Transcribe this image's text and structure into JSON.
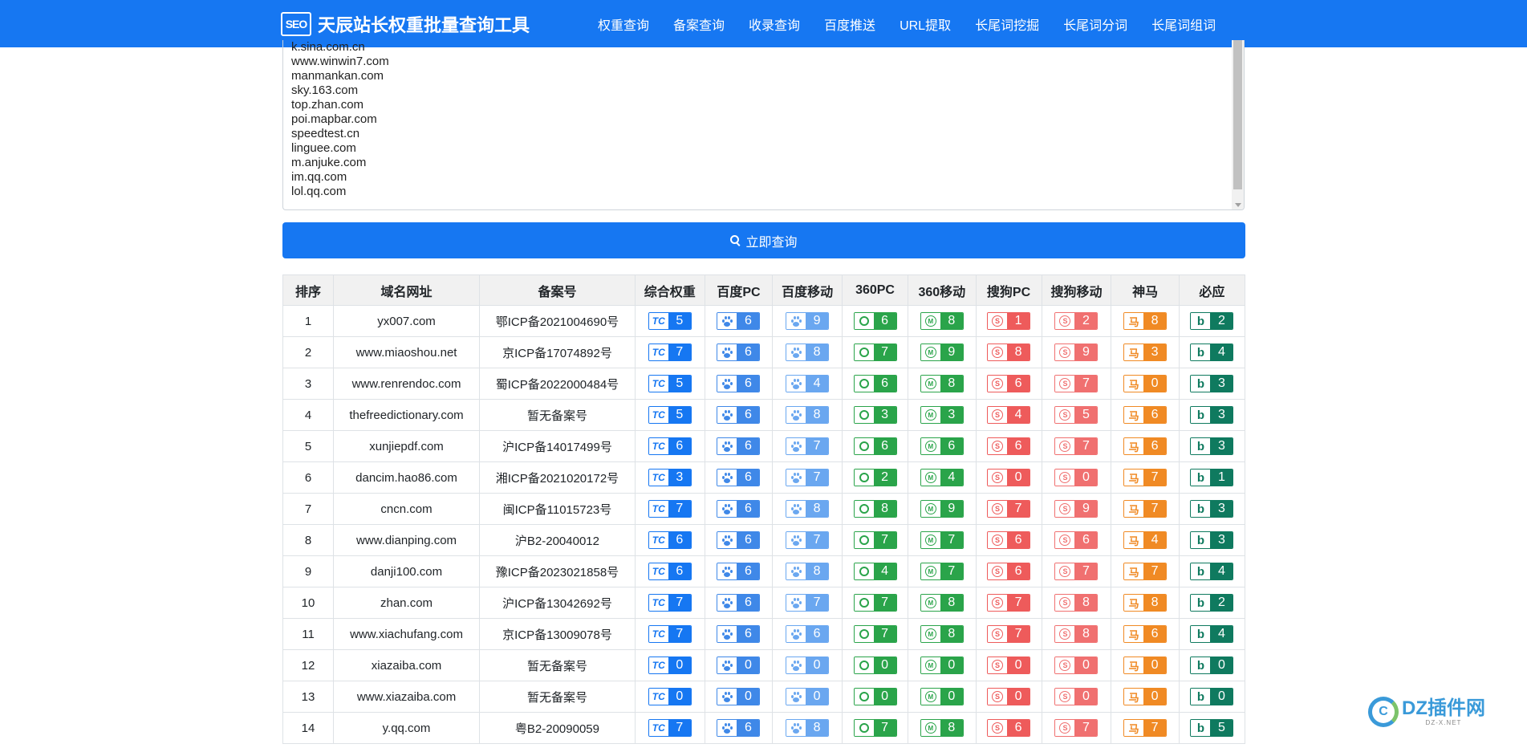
{
  "header": {
    "logo_text": "SEO",
    "title": "天辰站长权重批量查询工具",
    "nav": [
      "权重查询",
      "备案查询",
      "收录查询",
      "百度推送",
      "URL提取",
      "长尾词挖掘",
      "长尾词分词",
      "长尾词组词"
    ]
  },
  "textarea": {
    "lines": [
      "k.sina.com.cn",
      "www.winwin7.com",
      "manmankan.com",
      "sky.163.com",
      "top.zhan.com",
      "poi.mapbar.com",
      "speedtest.cn",
      "linguee.com",
      "m.anjuke.com",
      "im.qq.com",
      "lol.qq.com"
    ]
  },
  "query_button": {
    "label": "立即查询",
    "icon": "search-icon"
  },
  "table": {
    "headers": [
      "排序",
      "域名网址",
      "备案号",
      "综合权重",
      "百度PC",
      "百度移动",
      "360PC",
      "360移动",
      "搜狗PC",
      "搜狗移动",
      "神马",
      "必应"
    ],
    "engines": [
      {
        "key": "aizhan",
        "icon": "aizhan-icon",
        "glyph": "TC",
        "color": "#1677f2"
      },
      {
        "key": "baidu_pc",
        "icon": "baidu-paw-icon",
        "glyph": "",
        "color": "#3f88e8"
      },
      {
        "key": "baidu_m",
        "icon": "baidu-paw-icon",
        "glyph": "",
        "color": "#6aa7f0"
      },
      {
        "key": "s360_pc",
        "icon": "360-icon",
        "glyph": "",
        "color": "#2aa44a"
      },
      {
        "key": "s360_m",
        "icon": "360-mobile-icon",
        "glyph": "M",
        "color": "#2aa44a"
      },
      {
        "key": "sogou_pc",
        "icon": "sogou-icon",
        "glyph": "S",
        "color": "#ee5b5b"
      },
      {
        "key": "sogou_m",
        "icon": "sogou-mobile-icon",
        "glyph": "S",
        "color": "#f07070"
      },
      {
        "key": "shenma",
        "icon": "shenma-icon",
        "glyph": "马",
        "color": "#f08a24"
      },
      {
        "key": "bing",
        "icon": "bing-icon",
        "glyph": "b",
        "color": "#0f7a5f"
      }
    ],
    "rows": [
      {
        "rank": "1",
        "domain": "yx007.com",
        "icp": "鄂ICP备2021004690号",
        "scores": [
          "5",
          "6",
          "9",
          "6",
          "8",
          "1",
          "2",
          "8",
          "2"
        ]
      },
      {
        "rank": "2",
        "domain": "www.miaoshou.net",
        "icp": "京ICP备17074892号",
        "scores": [
          "7",
          "6",
          "8",
          "7",
          "9",
          "8",
          "9",
          "3",
          "4"
        ]
      },
      {
        "rank": "3",
        "domain": "www.renrendoc.com",
        "icp": "蜀ICP备2022000484号",
        "scores": [
          "5",
          "6",
          "4",
          "6",
          "8",
          "6",
          "7",
          "0",
          "3"
        ]
      },
      {
        "rank": "4",
        "domain": "thefreedictionary.com",
        "icp": "暂无备案号",
        "scores": [
          "5",
          "6",
          "8",
          "3",
          "3",
          "4",
          "5",
          "6",
          "3"
        ]
      },
      {
        "rank": "5",
        "domain": "xunjiepdf.com",
        "icp": "沪ICP备14017499号",
        "scores": [
          "6",
          "6",
          "7",
          "6",
          "6",
          "6",
          "7",
          "6",
          "3"
        ]
      },
      {
        "rank": "6",
        "domain": "dancim.hao86.com",
        "icp": "湘ICP备2021020172号",
        "scores": [
          "3",
          "6",
          "7",
          "2",
          "4",
          "0",
          "0",
          "7",
          "1"
        ]
      },
      {
        "rank": "7",
        "domain": "cncn.com",
        "icp": "闽ICP备11015723号",
        "scores": [
          "7",
          "6",
          "8",
          "8",
          "9",
          "7",
          "9",
          "7",
          "3"
        ]
      },
      {
        "rank": "8",
        "domain": "www.dianping.com",
        "icp": "沪B2-20040012",
        "scores": [
          "6",
          "6",
          "7",
          "7",
          "7",
          "6",
          "6",
          "4",
          "3"
        ]
      },
      {
        "rank": "9",
        "domain": "danji100.com",
        "icp": "豫ICP备2023021858号",
        "scores": [
          "6",
          "6",
          "8",
          "4",
          "7",
          "6",
          "7",
          "7",
          "4"
        ]
      },
      {
        "rank": "10",
        "domain": "zhan.com",
        "icp": "沪ICP备13042692号",
        "scores": [
          "7",
          "6",
          "7",
          "7",
          "8",
          "7",
          "8",
          "8",
          "2"
        ]
      },
      {
        "rank": "11",
        "domain": "www.xiachufang.com",
        "icp": "京ICP备13009078号",
        "scores": [
          "7",
          "6",
          "6",
          "7",
          "8",
          "7",
          "8",
          "6",
          "4"
        ]
      },
      {
        "rank": "12",
        "domain": "xiazaiba.com",
        "icp": "暂无备案号",
        "scores": [
          "0",
          "0",
          "0",
          "0",
          "0",
          "0",
          "0",
          "0",
          "0"
        ]
      },
      {
        "rank": "13",
        "domain": "www.xiazaiba.com",
        "icp": "暂无备案号",
        "scores": [
          "0",
          "0",
          "0",
          "0",
          "0",
          "0",
          "0",
          "0",
          "0"
        ]
      },
      {
        "rank": "14",
        "domain": "y.qq.com",
        "icp": "粤B2-20090059",
        "scores": [
          "7",
          "6",
          "8",
          "7",
          "8",
          "6",
          "7",
          "7",
          "5"
        ]
      }
    ]
  },
  "watermark": {
    "text": "DZ插件网",
    "sub": "DZ-X.NET"
  }
}
